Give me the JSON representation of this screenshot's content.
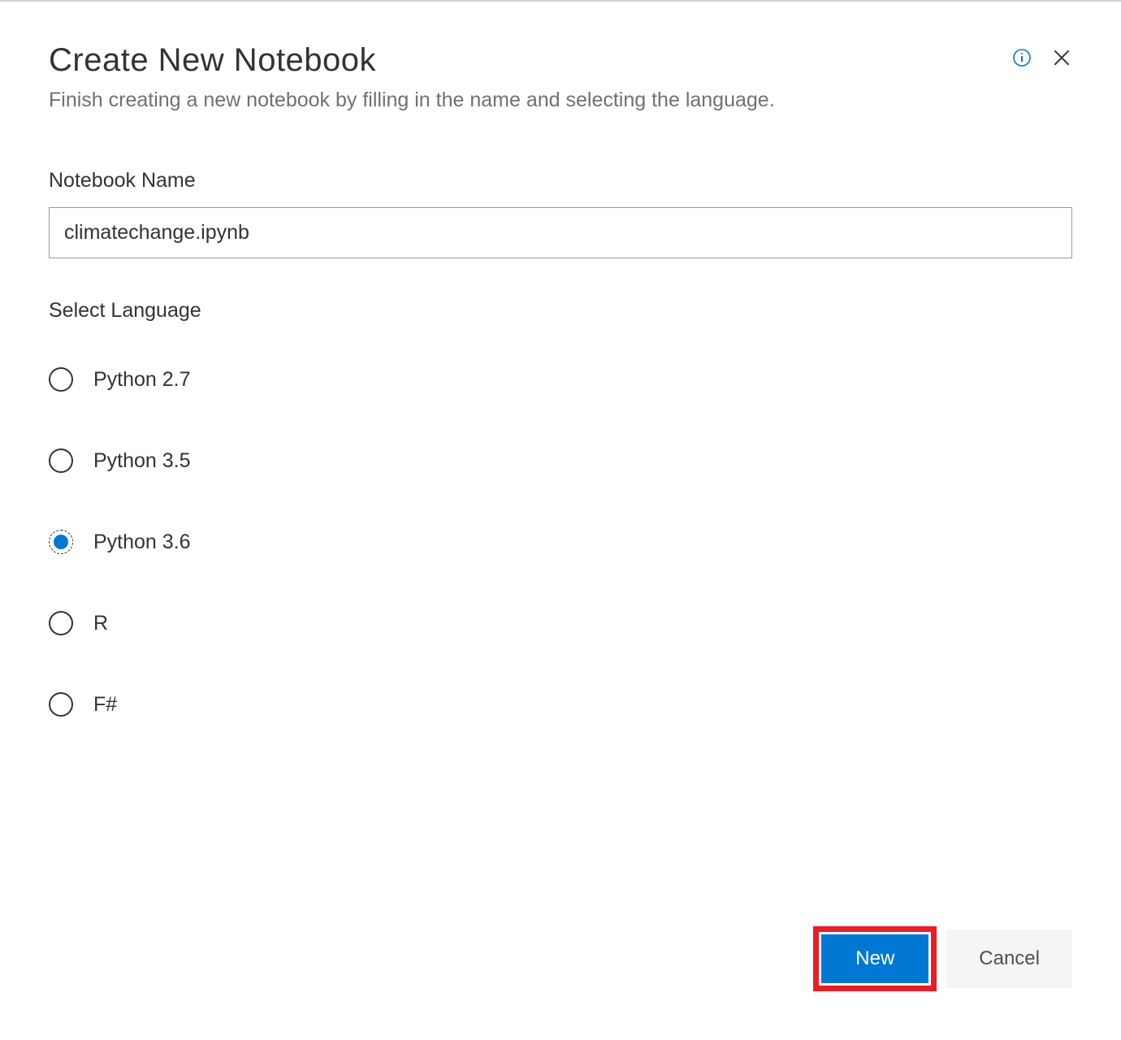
{
  "dialog": {
    "title": "Create New Notebook",
    "subtitle": "Finish creating a new notebook by filling in the name and selecting the language."
  },
  "form": {
    "name_label": "Notebook Name",
    "name_value": "climatechange.ipynb",
    "language_label": "Select Language",
    "languages": [
      {
        "label": "Python 2.7",
        "selected": false
      },
      {
        "label": "Python 3.5",
        "selected": false
      },
      {
        "label": "Python 3.6",
        "selected": true
      },
      {
        "label": "R",
        "selected": false
      },
      {
        "label": "F#",
        "selected": false
      }
    ]
  },
  "buttons": {
    "primary": "New",
    "secondary": "Cancel"
  },
  "colors": {
    "primary": "#0078d4",
    "highlight": "#ed1c24"
  }
}
